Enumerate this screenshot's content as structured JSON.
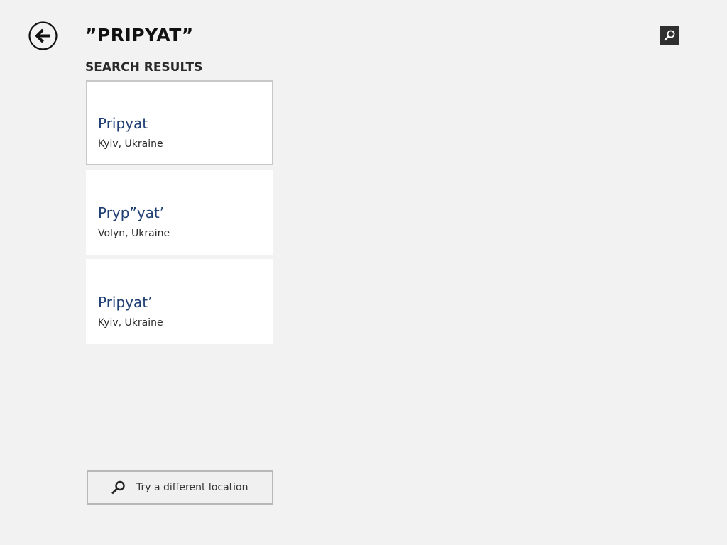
{
  "header": {
    "title": "”PRIPYAT”",
    "back_icon": "back-arrow-icon",
    "search_icon": "search-icon"
  },
  "results": {
    "heading": "SEARCH RESULTS",
    "items": [
      {
        "name": "Pripyat",
        "region": "Kyiv, Ukraine",
        "selected": true
      },
      {
        "name": "Pryp”yat’",
        "region": "Volyn, Ukraine",
        "selected": false
      },
      {
        "name": "Pripyat’",
        "region": "Kyiv, Ukraine",
        "selected": false
      }
    ]
  },
  "footer": {
    "try_different_label": "Try a different location",
    "try_different_icon": "search-icon"
  },
  "colors": {
    "background": "#f2f2f2",
    "tile": "#ffffff",
    "accent_text": "#1f3f74",
    "search_button_bg": "#2f2f2f"
  }
}
